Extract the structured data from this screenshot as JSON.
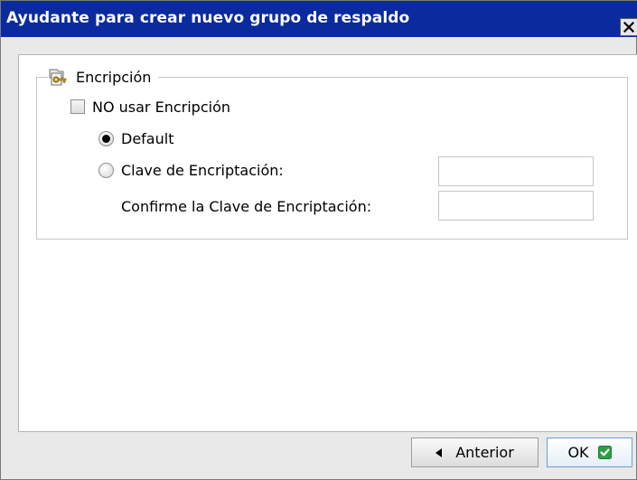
{
  "window": {
    "title": "Ayudante para crear nuevo grupo de respaldo",
    "close_icon": "close-icon"
  },
  "encryption": {
    "legend": "Encripción",
    "legend_icon": "key-folder-icon",
    "no_encryption_label": "NO usar Encripción",
    "no_encryption_checked": false,
    "default_label": "Default",
    "default_selected": true,
    "key_label": "Clave de Encriptación:",
    "key_selected": false,
    "key_value": "",
    "confirm_label": "Confirme la Clave de Encriptación:",
    "confirm_value": ""
  },
  "footer": {
    "back_label": "Anterior",
    "back_icon": "arrow-left-icon",
    "ok_label": "OK",
    "ok_icon": "checkmark-icon",
    "ok_icon_color": "#2ea043"
  }
}
